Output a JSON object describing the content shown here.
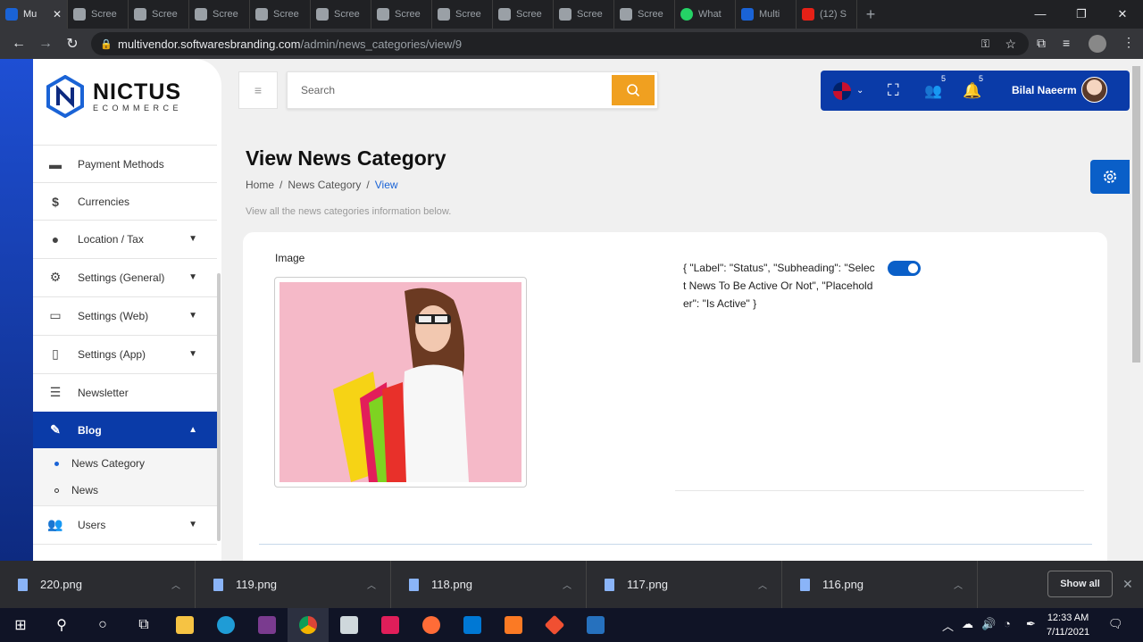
{
  "browser": {
    "tabs": [
      {
        "label": "Mu",
        "active": true
      },
      {
        "label": "Scree"
      },
      {
        "label": "Scree"
      },
      {
        "label": "Scree"
      },
      {
        "label": "Scree"
      },
      {
        "label": "Scree"
      },
      {
        "label": "Scree"
      },
      {
        "label": "Scree"
      },
      {
        "label": "Scree"
      },
      {
        "label": "Scree"
      },
      {
        "label": "Scree"
      },
      {
        "label": "Scree"
      },
      {
        "label": "What"
      },
      {
        "label": "Multi"
      },
      {
        "label": "(12) S"
      }
    ],
    "url_host": "multivendor.softwaresbranding.com",
    "url_path": "/admin/news_categories/view/9"
  },
  "logo": {
    "name": "NICTUS",
    "sub": "ECOMMERCE"
  },
  "sidebar": {
    "items": [
      {
        "label": "Payment Methods",
        "icon": "credit-card-icon"
      },
      {
        "label": "Currencies",
        "icon": "dollar-icon"
      },
      {
        "label": "Location / Tax",
        "icon": "location-pin-icon"
      },
      {
        "label": "Settings (General)",
        "icon": "gear-icon"
      },
      {
        "label": "Settings (Web)",
        "icon": "laptop-icon"
      },
      {
        "label": "Settings (App)",
        "icon": "mobile-icon"
      },
      {
        "label": "Newsletter",
        "icon": "newspaper-icon"
      },
      {
        "label": "Blog",
        "icon": "blog-icon"
      },
      {
        "label": "Users",
        "icon": "users-icon"
      }
    ],
    "subitems": [
      {
        "label": "News Category"
      },
      {
        "label": "News"
      }
    ]
  },
  "header": {
    "search_placeholder": "Search",
    "contacts_badge": "5",
    "notifications_badge": "5",
    "user_name": "Bilal Naeerm"
  },
  "main": {
    "title": "View News Category",
    "breadcrumb": [
      "Home",
      "News Category",
      "View"
    ],
    "breadcrumb_sep": "/",
    "description": "View all the news categories information below.",
    "image_label": "Image",
    "status_label": "{ \"Label\": \"Status\", \"Subheading\": \"Select News To Be Active Or Not\", \"Placeholder\": \"Is Active\" }",
    "status_active": true
  },
  "downloads": {
    "files": [
      "220.png",
      "119.png",
      "118.png",
      "117.png",
      "116.png"
    ],
    "show_all": "Show all"
  },
  "taskbar": {
    "time": "12:33 AM",
    "date": "7/11/2021"
  },
  "colors": {
    "primary": "#0a3ba8",
    "accent": "#f0a020",
    "link": "#1a63d6"
  }
}
